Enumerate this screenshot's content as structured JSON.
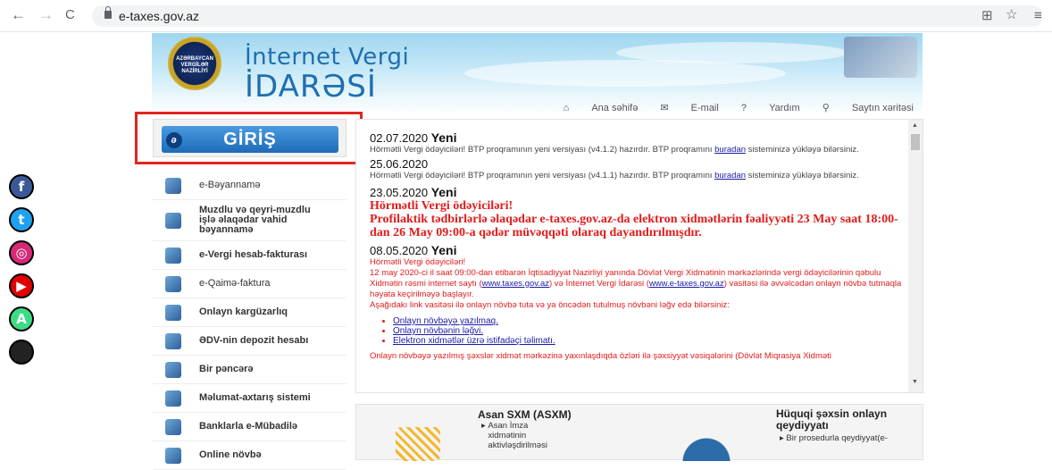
{
  "browser": {
    "url": "e-taxes.gov.az",
    "back": "←",
    "forward": "→",
    "reload": "C",
    "translate": "⊞",
    "star": "☆",
    "menu": "≡"
  },
  "header": {
    "emblem_text": "AZƏRBAYCAN VERGİLƏR NAZİRLİYİ",
    "title_line1": "İnternet Vergi",
    "title_line2": "İDARƏSİ",
    "links": [
      "Ana səhifə",
      "E-mail",
      "Yardım",
      "Saytın xəritəsi"
    ]
  },
  "login": {
    "label": "GİRİŞ",
    "icon": "ə"
  },
  "social": [
    {
      "name": "facebook",
      "glyph": "f",
      "color": "#3b5998"
    },
    {
      "name": "twitter",
      "glyph": "t",
      "color": "#1da1f2"
    },
    {
      "name": "instagram",
      "glyph": "◎",
      "color": "#d62976"
    },
    {
      "name": "youtube",
      "glyph": "▶",
      "color": "#e00000"
    },
    {
      "name": "android",
      "glyph": "A",
      "color": "#3ddc84"
    },
    {
      "name": "apple",
      "glyph": "",
      "color": "#222222"
    }
  ],
  "menu": [
    {
      "label": "e-Bəyannamə",
      "bold": false
    },
    {
      "label": "Muzdlu və qeyri-muzdlu işlə əlaqədar vahid bəyannamə",
      "bold": true
    },
    {
      "label": "e-Vergi hesab-fakturası",
      "bold": true
    },
    {
      "label": "e-Qaimə-faktura",
      "bold": false
    },
    {
      "label": "Onlayn kargüzarlıq",
      "bold": true
    },
    {
      "label": "ƏDV-nin depozit hesabı",
      "bold": true
    },
    {
      "label": "Bir pəncərə",
      "bold": true
    },
    {
      "label": "Məlumat-axtarış sistemi",
      "bold": true
    },
    {
      "label": "Banklarla e-Mübadilə",
      "bold": true
    },
    {
      "label": "Online növbə",
      "bold": true
    }
  ],
  "news": {
    "n1_date": "02.07.2020",
    "n1_badge": "Yeni",
    "n1_text_a": "Hörmətli Vergi ödəyiciləri! BTP proqramının yeni versiyası (v4.1.2) hazırdır. BTP proqramını",
    "n1_link": "buradan",
    "n1_text_b": "sisteminizə yükləyə bilərsiniz.",
    "n2_date": "25.06.2020",
    "n2_text_a": "Hörmətli Vergi ödəyiciləri! BTP proqramının yeni versiyası (v4.1.1) hazırdır. BTP proqramını",
    "n2_link": "buradan",
    "n2_text_b": "sisteminizə yükləyə bilərsiniz.",
    "n3_date": "23.05.2020",
    "n3_badge": "Yeni",
    "n3_head": "Hörmətli Vergi ödəyiciləri!",
    "n3_body": "Profilaktik tədbirlərlə əlaqədar e-taxes.gov.az-da elektron xidmətlərin fəaliyyəti 23 May saat 18:00-dan 26 May 09:00-a qədər müvəqqəti olaraq dayandırılmışdır.",
    "n4_date": "08.05.2020",
    "n4_badge": "Yeni",
    "n4_greet": "Hörmətli Vergi ödəyiciləri!",
    "n4_p1_a": "12 may 2020-ci il saat 09:00-dan etibarən İqtisadiyyat Nazirliyi yanında Dövlət Vergi Xidmətinin mərkəzlərində vergi ödəyicilərinin qəbulu Xidmətin rəsmi internet saytı (",
    "n4_link1": "www.taxes.gov.az",
    "n4_p1_b": ") və İnternet Vergi İdarəsi (",
    "n4_link2": "www.e-taxes.gov.az",
    "n4_p1_c": ") vasitəsi ilə əvvəlcədən onlayn növbə tutmaqla həyata keçirilməyə başlayır.",
    "n4_p2": "Aşağıdakı link vasitəsi ilə onlayn növbə tuta və ya öncədən tutulmuş növbəni ləğv edə bilərsiniz:",
    "n4_list": [
      "Onlayn növbəyə yazılmaq.",
      "Onlayn növbənin ləğvi.",
      "Elektron xidmətlər üzrə istifadəçi təlimatı."
    ],
    "n4_p3": "Onlayn növbəyə yazılmış şəxslər xidmət mərkəzinə yaxınlaşdıqda özləri ilə şəxsiyyət vəsiqələrini (Dövlət Miqrasiya Xidməti"
  },
  "bottom": {
    "asan_title": "Asan SXM (ASXM)",
    "asan_sub": "Asan İmza xidmətinin aktivləşdirilməsi",
    "hs_title": "Hüquqi şəxsin onlayn qeydiyyatı",
    "hs_sub": "Bir prosedurla qeydiyyat(e-"
  }
}
